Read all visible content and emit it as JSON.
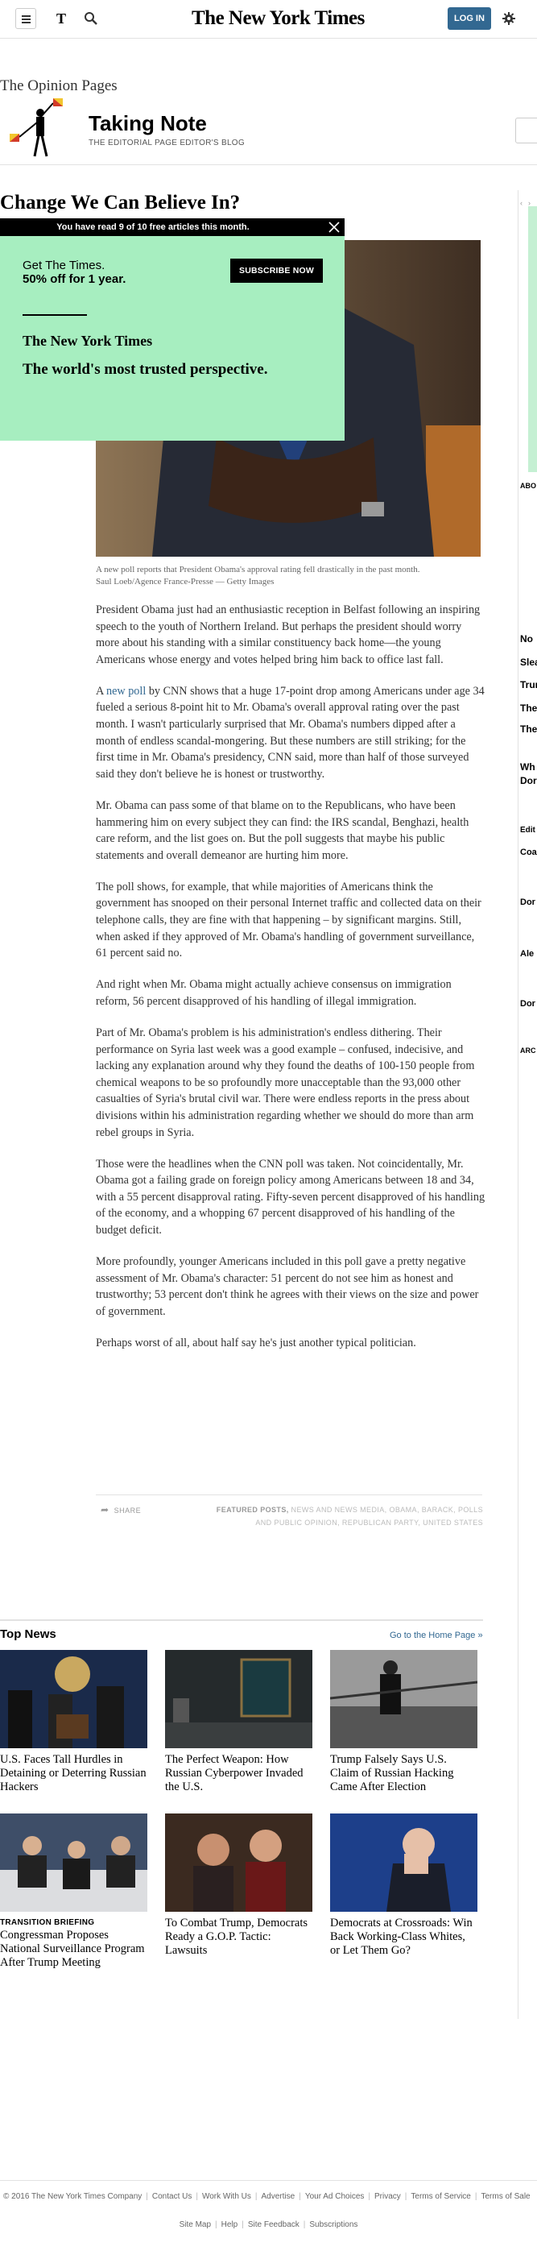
{
  "header": {
    "masthead": "The New York Times",
    "login_label": "LOG IN"
  },
  "blog": {
    "section": "The Opinion Pages",
    "title": "Taking Note",
    "subtitle": "THE EDITORIAL PAGE EDITOR'S BLOG"
  },
  "article": {
    "title": "Change We Can Believe In?",
    "caption": "A new poll reports that President Obama's approval rating fell drastically in the past month.",
    "credit": "Saul Loeb/Agence France-Presse — Getty Images",
    "paragraphs": [
      "President Obama just had an enthusiastic reception in Belfast following an inspiring speech to the youth of Northern Ireland. But perhaps the president should worry more about his standing with a similar constituency back home—the young Americans whose energy and votes helped bring him back to office last fall.",
      "The poll shows, for example, that while majorities of Americans think the government has snooped on their personal Internet traffic and collected data on their telephone calls, they are fine with that happening – by significant margins. Still, when asked if they approved of Mr. Obama's handling of government surveillance, 61 percent said no.",
      "And right when Mr. Obama might actually achieve consensus on immigration reform, 56 percent disapproved of his handling of illegal immigration.",
      "Part of Mr. Obama's problem is his administration's endless dithering. Their performance on Syria last week was a good example – confused, indecisive, and lacking any explanation around why they found the deaths of 100-150 people from chemical weapons to be so profoundly more unacceptable than the 93,000 other casualties of Syria's brutal civil war. There were endless reports in the press about divisions within his administration regarding whether we should do more than arm rebel groups in Syria.",
      "Those were the headlines when the CNN poll was taken. Not coincidentally, Mr. Obama got a failing grade on foreign policy among Americans between 18 and 34, with a 55 percent disapproval rating. Fifty-seven percent disapproved of his handling of the economy, and a whopping 67 percent disapproved of his handling of the budget deficit.",
      "More profoundly, younger Americans included in this poll gave a pretty negative assessment of Mr. Obama's character: 51 percent do not see him as honest and trustworthy; 53 percent don't think he agrees with their views on the size and power of government.",
      "Perhaps worst of all, about half say he's just another typical politician."
    ],
    "p2_prefix": "A",
    "p2_link": " new poll",
    "p2_rest": " by CNN shows that a huge 17-point drop among Americans under age 34 fueled a serious 8-point hit to Mr. Obama's overall approval rating over the past month. I wasn't particularly surprised that Mr. Obama's numbers dipped after a month of endless scandal-mongering. But these numbers are still striking; for the first time in Mr. Obama's presidency, CNN said, more than half of those surveyed said they don't believe he is honest or trustworthy.",
    "p3": "Mr. Obama can pass some of that blame on to the Republicans, who have been hammering him on every subject they can find: the IRS scandal, Benghazi, health care reform, and the list goes on. But the poll suggests that maybe his public statements and overall demeanor are hurting him more.",
    "share_label": "SHARE",
    "featured_label": "FEATURED POSTS,",
    "featured_tags": " NEWS AND NEWS MEDIA, OBAMA, BARACK, POLLS AND PUBLIC OPINION, REPUBLICAN PARTY, UNITED STATES"
  },
  "paywall": {
    "meter": "You have read 9 of 10 free articles this month.",
    "offer_line1": "Get The Times.",
    "offer_line2": "50% off for 1 year.",
    "subscribe_label": "SUBSCRIBE NOW",
    "logo": "The New York Times",
    "tagline": "The world's most trusted perspective."
  },
  "top_news": {
    "title": "Top News",
    "home_link": "Go to the Home Page »",
    "stories": [
      {
        "kicker": "",
        "headline": "U.S. Faces Tall Hurdles in Detaining or Deterring Russian Hackers"
      },
      {
        "kicker": "",
        "headline": "The Perfect Weapon: How Russian Cyberpower Invaded the U.S."
      },
      {
        "kicker": "",
        "headline": "Trump Falsely Says U.S. Claim of Russian Hacking Came After Election"
      },
      {
        "kicker": "TRANSITION BRIEFING",
        "headline": "Congressman Proposes National Surveillance Program After Trump Meeting"
      },
      {
        "kicker": "",
        "headline": "To Combat Trump, Democrats Ready a G.O.P. Tactic: Lawsuits"
      },
      {
        "kicker": "",
        "headline": "Democrats at Crossroads: Win Back Working-Class Whites, or Let Them Go?"
      }
    ]
  },
  "right_rail": {
    "labels": [
      "ABO",
      "No",
      "Slea",
      "Trur",
      "The",
      "The",
      "Wh",
      "Dor",
      "Edit",
      "Coa",
      "Dor",
      "Ale",
      "Dor",
      "ARC"
    ]
  },
  "footer": {
    "links": [
      "© 2016 The New York Times Company",
      "Contact Us",
      "Work With Us",
      "Advertise",
      "Your Ad Choices",
      "Privacy",
      "Terms of Service",
      "Terms of Sale"
    ],
    "links2": [
      "Site Map",
      "Help",
      "Site Feedback",
      "Subscriptions"
    ]
  }
}
